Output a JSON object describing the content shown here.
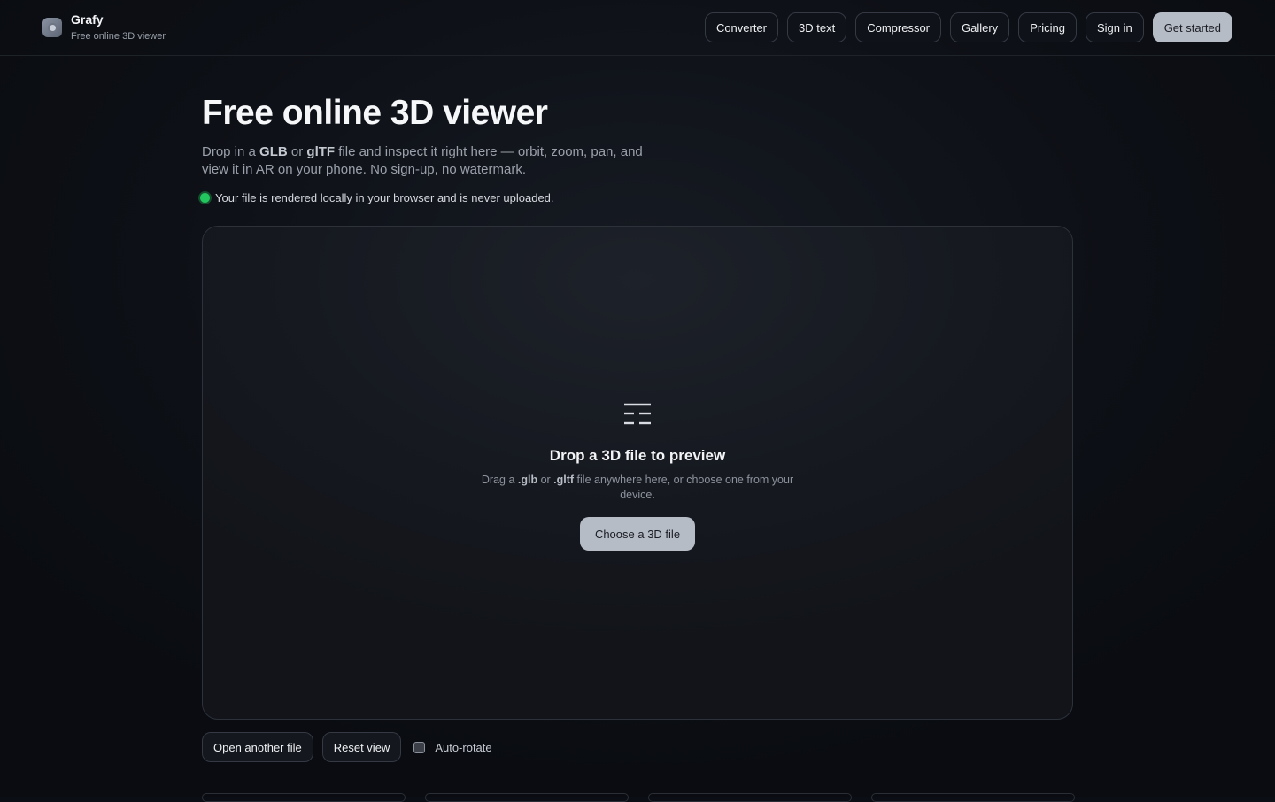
{
  "brand": {
    "name": "Grafy",
    "subtitle": "Free online 3D viewer"
  },
  "nav": {
    "items": [
      "Converter",
      "3D text",
      "Compressor",
      "Gallery",
      "Pricing",
      "Sign in"
    ],
    "cta": "Get started"
  },
  "hero": {
    "title": "Free online 3D viewer",
    "desc_part1": "Drop in a ",
    "desc_glb": "GLB",
    "desc_part2": " or ",
    "desc_gltf": "glTF",
    "desc_part3": " file and inspect it right here — orbit, zoom, pan, and view it in AR on your phone. No sign-up, no watermark.",
    "privacy_note": "Your file is rendered locally in your browser and is never uploaded."
  },
  "dropzone": {
    "icon": "list-lines-icon",
    "title": "Drop a 3D file to preview",
    "sub_part1": "Drag a ",
    "sub_glb": ".glb",
    "sub_part2": " or ",
    "sub_gltf": ".gltf",
    "sub_part3": " file anywhere here, or choose one from your device.",
    "button": "Choose a 3D file"
  },
  "controls": {
    "open_another": "Open another file",
    "reset_view": "Reset view",
    "auto_rotate_label": "Auto-rotate",
    "auto_rotate_checked": false
  },
  "colors": {
    "background": "#0b0e14",
    "primary_button": "#b6bcc6",
    "status_dot": "#22c55e"
  }
}
